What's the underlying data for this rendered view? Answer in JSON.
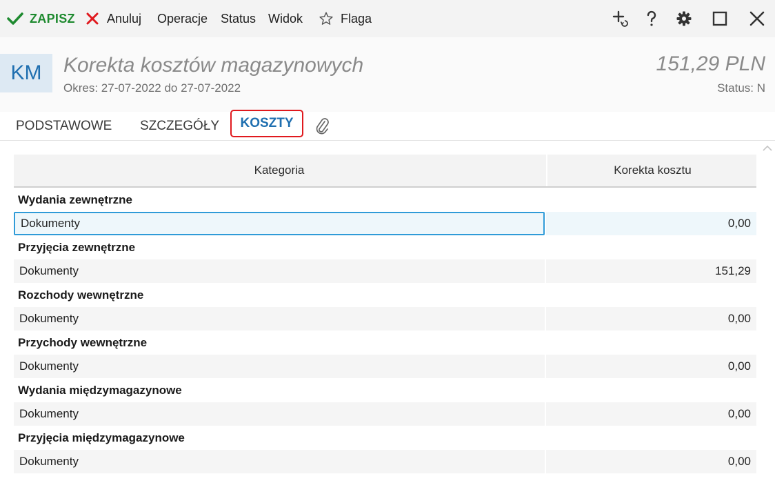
{
  "toolbar": {
    "save_label": "ZAPISZ",
    "cancel_label": "Anuluj",
    "operations_label": "Operacje",
    "status_label": "Status",
    "view_label": "Widok",
    "flag_label": "Flaga",
    "icons": [
      "check-icon",
      "close-x-icon",
      "star-icon",
      "add-refresh-icon",
      "help-icon",
      "gear-icon",
      "maximize-icon",
      "close-icon"
    ]
  },
  "header": {
    "badge": "KM",
    "title": "Korekta kosztów magazynowych",
    "period": "Okres: 27-07-2022 do 27-07-2022",
    "amount": "151,29 PLN",
    "status": "Status: N"
  },
  "tabs": {
    "basic": "PODSTAWOWE",
    "details": "SZCZEGÓŁY",
    "costs": "KOSZTY",
    "active": "KOSZTY"
  },
  "grid": {
    "columns": {
      "category": "Kategoria",
      "correction": "Korekta kosztu"
    },
    "groups": [
      {
        "name": "Wydania zewnętrzne",
        "row_label": "Dokumenty",
        "value": "0,00"
      },
      {
        "name": "Przyjęcia zewnętrzne",
        "row_label": "Dokumenty",
        "value": "151,29"
      },
      {
        "name": "Rozchody wewnętrzne",
        "row_label": "Dokumenty",
        "value": "0,00"
      },
      {
        "name": "Przychody wewnętrzne",
        "row_label": "Dokumenty",
        "value": "0,00"
      },
      {
        "name": "Wydania międzymagazynowe",
        "row_label": "Dokumenty",
        "value": "0,00"
      },
      {
        "name": "Przyjęcia międzymagazynowe",
        "row_label": "Dokumenty",
        "value": "0,00"
      }
    ]
  },
  "colors": {
    "accent": "#1f6fb0",
    "save_green": "#1e8a2f",
    "cancel_red": "#e0191e",
    "selection_border": "#2f9bd8"
  }
}
